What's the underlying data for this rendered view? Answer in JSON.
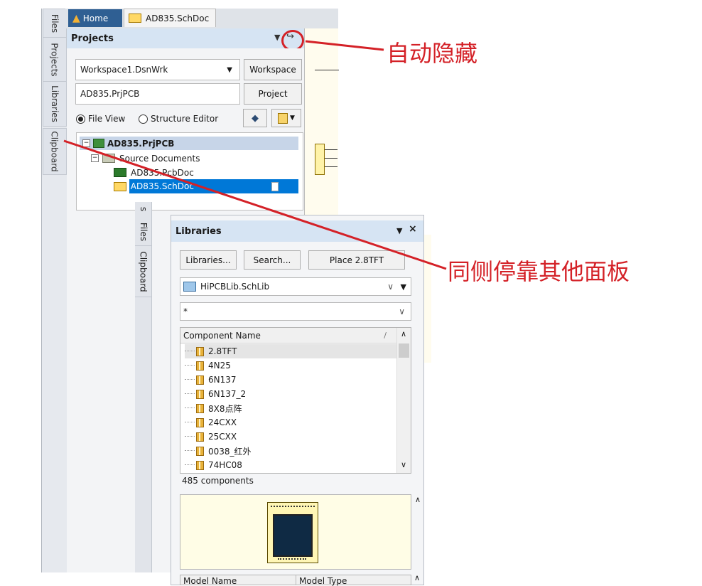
{
  "doc_tabs": {
    "home": "Home",
    "schdoc": "AD835.SchDoc"
  },
  "side_tabs_left": [
    "Files",
    "Projects",
    "Libraries",
    "Clipboard"
  ],
  "projects_panel": {
    "title": "Projects",
    "workspace_value": "Workspace1.DsnWrk",
    "workspace_button": "Workspace",
    "project_value": "AD835.PrjPCB",
    "project_button": "Project",
    "radio_file_view": "File View",
    "radio_structure_editor": "Structure Editor",
    "tree": {
      "root": "AD835.PrjPCB",
      "folder": "Source Documents",
      "pcbdoc": "AD835.PcbDoc",
      "schdoc": "AD835.SchDoc"
    }
  },
  "side_tabs_inner": [
    "s",
    "Files",
    "Clipboard"
  ],
  "libraries_panel": {
    "title": "Libraries",
    "btn_libraries": "Libraries...",
    "btn_search": "Search...",
    "btn_place": "Place 2.8TFT",
    "library_value": "HiPCBLib.SchLib",
    "filter_value": "*",
    "column_header": "Component Name",
    "components": [
      "2.8TFT",
      "4N25",
      "6N137",
      "6N137_2",
      "8X8点阵",
      "24CXX",
      "25CXX",
      "0038_红外",
      "74HC08"
    ],
    "count_text": "485 components",
    "model_name_header": "Model Name",
    "model_type_header": "Model Type"
  },
  "annotations": {
    "auto_hide": "自动隐藏",
    "dock_same_side": "同侧停靠其他面板"
  },
  "colors": {
    "annotation_red": "#d42127",
    "selection_blue": "#0078d7",
    "title_bar": "#d6e4f3",
    "preview_bg": "#fffde6"
  }
}
